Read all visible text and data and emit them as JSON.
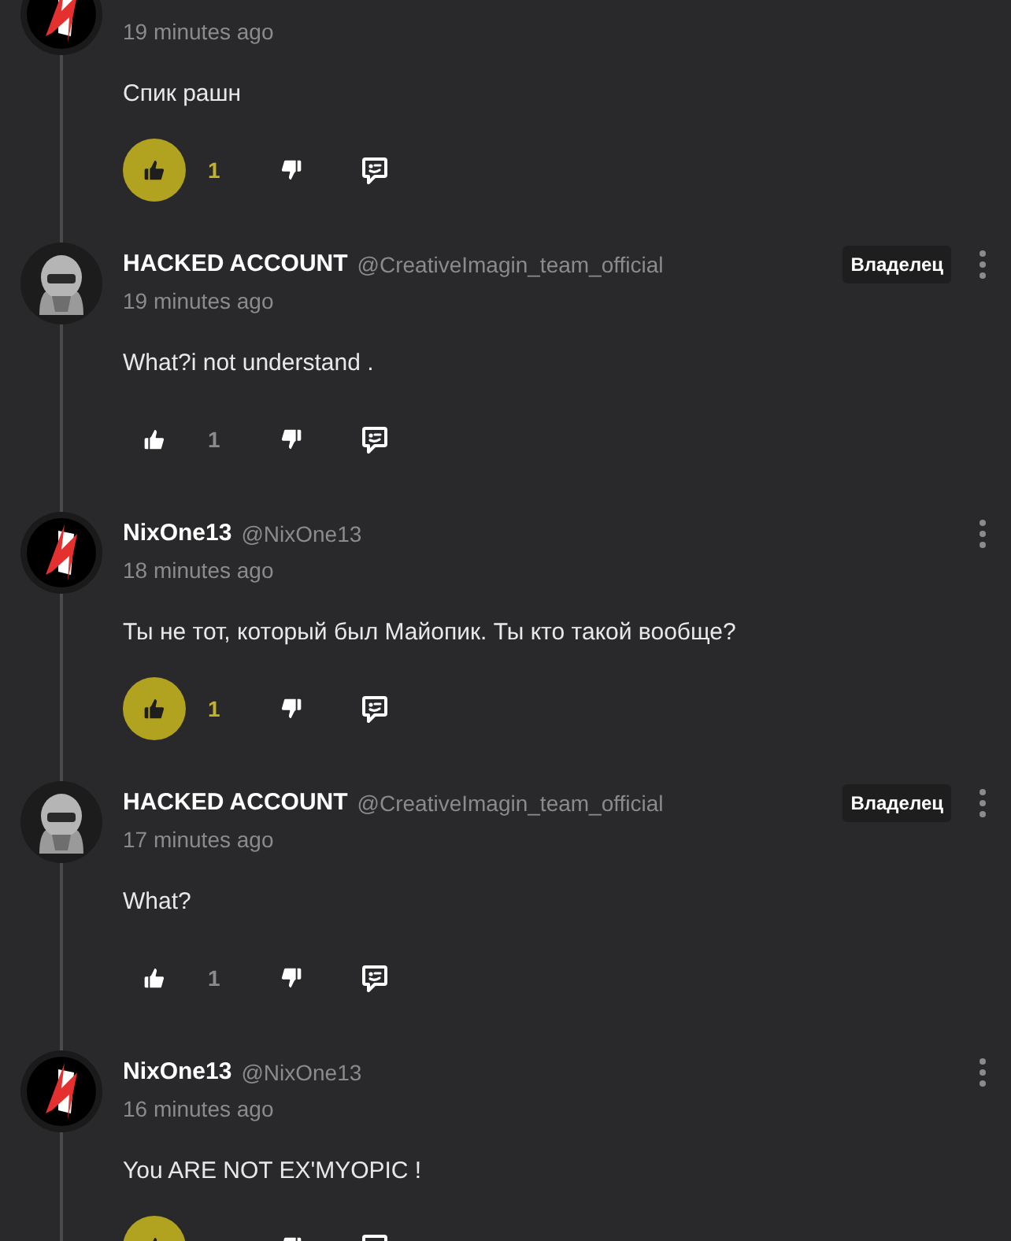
{
  "comments": [
    {
      "avatar": {
        "kind": "bolt"
      },
      "time": "19 minutes ago",
      "text": "Спик рашн",
      "liked": true,
      "likes": "1"
    },
    {
      "avatar": {
        "kind": "hood"
      },
      "name": "HACKED ACCOUNT",
      "handle": "@CreativeImagin_team_official",
      "badge": "Владелец",
      "time": "19 minutes ago",
      "text": "What?i not understand .",
      "liked": false,
      "likes": "1"
    },
    {
      "avatar": {
        "kind": "bolt"
      },
      "name": "NixOne13",
      "handle": "@NixOne13",
      "time": "18 minutes ago",
      "text": "Ты не тот, который был Майопик. Ты кто такой вообще?",
      "liked": true,
      "likes": "1"
    },
    {
      "avatar": {
        "kind": "hood"
      },
      "name": "HACKED ACCOUNT",
      "handle": "@CreativeImagin_team_official",
      "badge": "Владелец",
      "time": "17 minutes ago",
      "text": "What?",
      "liked": false,
      "likes": "1"
    },
    {
      "avatar": {
        "kind": "bolt"
      },
      "name": "NixOne13",
      "handle": "@NixOne13",
      "time": "16 minutes ago",
      "text": "You ARE NOT EX'MYOPIC !",
      "liked": true
    }
  ]
}
